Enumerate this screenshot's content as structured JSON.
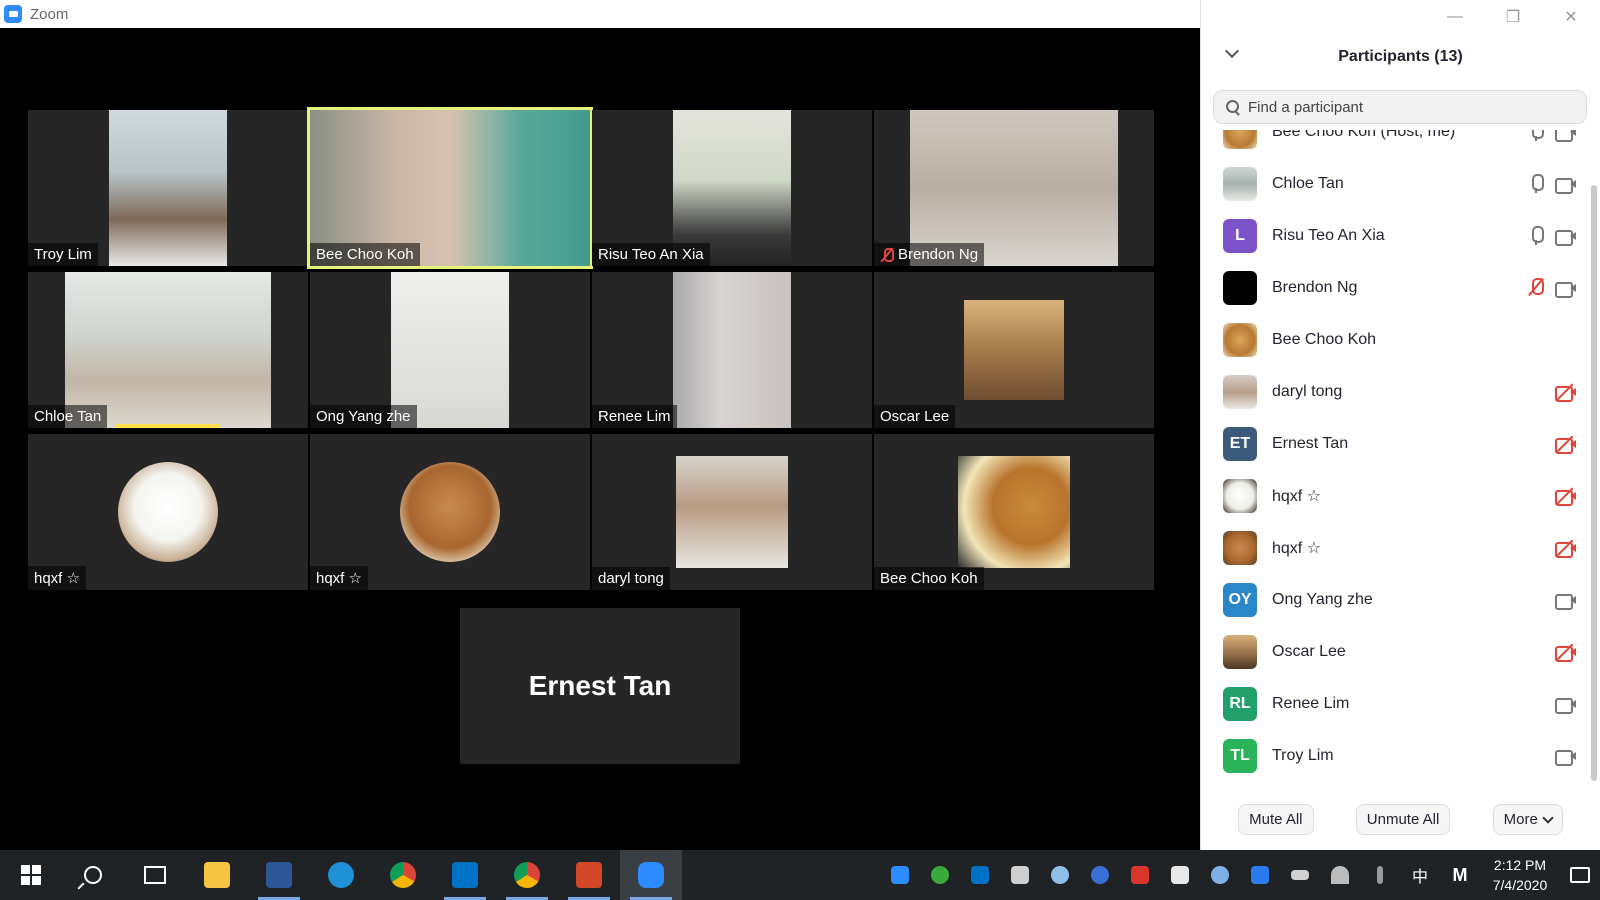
{
  "window": {
    "app_title": "Zoom",
    "minimize": "—",
    "restore": "❐",
    "close": "✕"
  },
  "gallery": {
    "tiles": [
      {
        "name": "Troy Lim"
      },
      {
        "name": "Bee Choo Koh",
        "active": true
      },
      {
        "name": "Risu Teo An Xia"
      },
      {
        "name": "Brendon Ng",
        "muted": true
      },
      {
        "name": "Chloe Tan",
        "speaking": true
      },
      {
        "name": "Ong Yang zhe"
      },
      {
        "name": "Renee Lim"
      },
      {
        "name": "Oscar Lee"
      },
      {
        "name": "hqxf ☆"
      },
      {
        "name": "hqxf ☆"
      },
      {
        "name": "daryl tong"
      },
      {
        "name": "Bee Choo Koh"
      }
    ],
    "no_video_tile": {
      "name": "Ernest Tan"
    }
  },
  "panel": {
    "title": "Participants (13)",
    "search_placeholder": "Find a participant",
    "participants": [
      {
        "name": "Bee Choo Koh (Host, me)",
        "avatar": "bear-photo",
        "mic": "on",
        "cam": "on"
      },
      {
        "name": "Chloe Tan",
        "avatar": "photo",
        "mic": "on",
        "cam": "on"
      },
      {
        "name": "Risu Teo An Xia",
        "initials": "L",
        "color": "#7b52c7",
        "mic": "on",
        "cam": "on"
      },
      {
        "name": "Brendon Ng",
        "avatar": "black",
        "mic": "muted",
        "cam": "on"
      },
      {
        "name": "Bee Choo Koh",
        "avatar": "bear-photo",
        "mic": "none",
        "cam": "none"
      },
      {
        "name": "daryl tong",
        "avatar": "photo",
        "mic": "none",
        "cam": "off"
      },
      {
        "name": "Ernest Tan",
        "initials": "ET",
        "color": "#3b5a7a",
        "mic": "none",
        "cam": "off"
      },
      {
        "name": "hqxf ☆",
        "avatar": "white-bear",
        "mic": "none",
        "cam": "off"
      },
      {
        "name": "hqxf ☆",
        "avatar": "brown-bear",
        "mic": "none",
        "cam": "off"
      },
      {
        "name": "Ong Yang zhe",
        "initials": "OY",
        "color": "#2a87c9",
        "mic": "none",
        "cam": "on"
      },
      {
        "name": "Oscar Lee",
        "avatar": "photo",
        "mic": "none",
        "cam": "off"
      },
      {
        "name": "Renee Lim",
        "initials": "RL",
        "color": "#22a06b",
        "mic": "none",
        "cam": "on"
      },
      {
        "name": "Troy Lim",
        "initials": "TL",
        "color": "#2bb35a",
        "mic": "none",
        "cam": "on"
      }
    ],
    "actions": {
      "mute_all": "Mute All",
      "unmute_all": "Unmute All",
      "more": "More"
    }
  },
  "taskbar": {
    "apps": [
      "windows-start",
      "search",
      "task-view",
      "file-explorer",
      "word",
      "internet-explorer",
      "chrome",
      "outlook",
      "chrome-profile",
      "powerpoint",
      "zoom"
    ],
    "clock_time": "2:12 PM",
    "clock_date": "7/4/2020",
    "ime": "中",
    "ime_mode": "M"
  },
  "colors": {
    "accent": "#2d8cff",
    "active_speaker": "#e6f37a",
    "muted_red": "#e0453a"
  }
}
